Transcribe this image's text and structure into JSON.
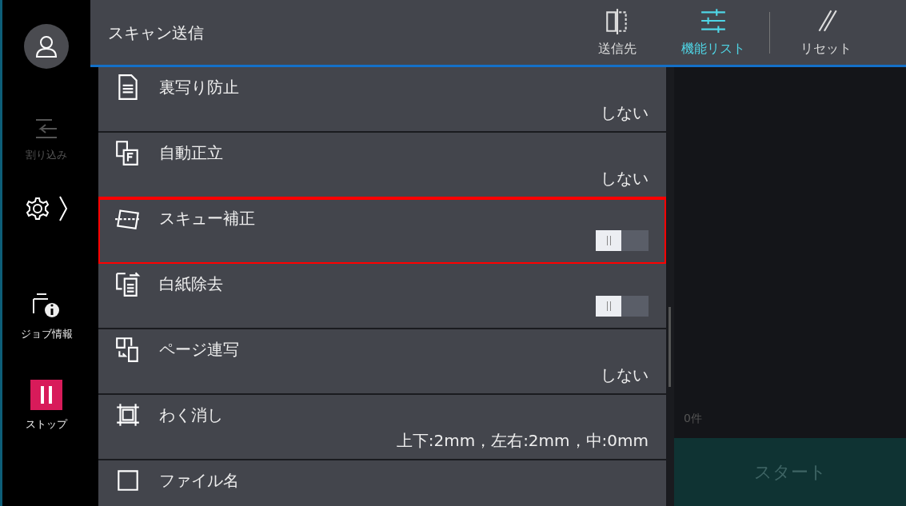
{
  "header": {
    "title": "スキャン送信",
    "tabs": [
      {
        "label": "送信先",
        "selected": false
      },
      {
        "label": "機能リスト",
        "selected": true
      },
      {
        "label": "リセット",
        "selected": false
      }
    ]
  },
  "sidebar": {
    "items": [
      {
        "label": "割り込み",
        "kind": "interrupt",
        "disabled": true
      },
      {
        "label": "ジョブ情報",
        "kind": "jobinfo",
        "disabled": false
      },
      {
        "label": "ストップ",
        "kind": "stop",
        "disabled": false
      }
    ]
  },
  "features": [
    {
      "label": "裏写り防止",
      "kind": "value",
      "value": "しない",
      "highlighted": false
    },
    {
      "label": "自動正立",
      "kind": "value",
      "value": "しない",
      "highlighted": false
    },
    {
      "label": "スキュー補正",
      "kind": "toggle",
      "on": false,
      "highlighted": true
    },
    {
      "label": "白紙除去",
      "kind": "toggle",
      "on": false,
      "highlighted": false
    },
    {
      "label": "ページ連写",
      "kind": "value",
      "value": "しない",
      "highlighted": false
    },
    {
      "label": "わく消し",
      "kind": "value",
      "value": "上下:2mm，左右:2mm，中:0mm",
      "highlighted": false
    },
    {
      "label": "ファイル名",
      "kind": "value",
      "highlighted": false
    }
  ],
  "job_count": "0件",
  "start_button": {
    "label": "スタート",
    "disabled": true
  }
}
